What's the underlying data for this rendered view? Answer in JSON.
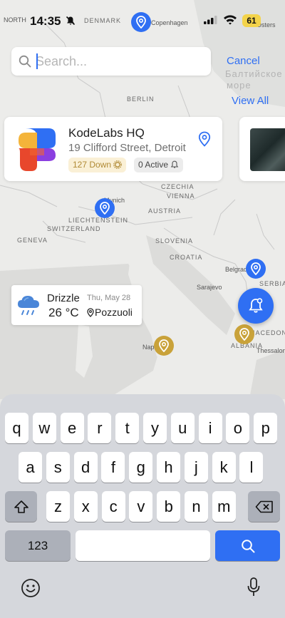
{
  "status_bar": {
    "time": "14:35",
    "battery": "61"
  },
  "map": {
    "labels": {
      "denmark": "DENMARK",
      "copenhagen": "Copenhagen",
      "baltic": "Балтийское",
      "baltic2": "море",
      "berlin": "BERLIN",
      "czechia": "CZECHIA",
      "munich": "Munich",
      "vienna": "VIENNA",
      "austria": "AUSTRIA",
      "liechtenstein": "LIECHTENSTEIN",
      "switzerland": "SWITZERLAND",
      "geneva": "GENEVA",
      "slovenia": "SLOVENIA",
      "croatia": "CROATIA",
      "belgrade": "Belgrad",
      "serbia": "SERBIA",
      "sarajevo": "Sarajevo",
      "naples": "Nap",
      "macedonia": "MACEDONI",
      "albania": "ALBANIA",
      "thessaloniki": "Thessalonik",
      "north": "NORTH",
      "osters": "Osters"
    }
  },
  "search": {
    "placeholder": "Search...",
    "value": "",
    "cancel_label": "Cancel"
  },
  "view_all_label": "View All",
  "site_card": {
    "name": "KodeLabs HQ",
    "address": "19 Clifford Street, Detroit",
    "down_label": "127 Down",
    "active_label": "0 Active"
  },
  "weather": {
    "condition": "Drizzle",
    "temperature": "26 °C",
    "date": "Thu, May 28",
    "place": "Pozzuoli"
  },
  "keyboard": {
    "row1": [
      "q",
      "w",
      "e",
      "r",
      "t",
      "y",
      "u",
      "i",
      "o",
      "p"
    ],
    "row2": [
      "a",
      "s",
      "d",
      "f",
      "g",
      "h",
      "j",
      "k",
      "l"
    ],
    "row3": [
      "z",
      "x",
      "c",
      "v",
      "b",
      "n",
      "m"
    ],
    "numbers_label": "123"
  },
  "colors": {
    "accent": "#2f6ff3",
    "gold": "#c9a23a"
  }
}
